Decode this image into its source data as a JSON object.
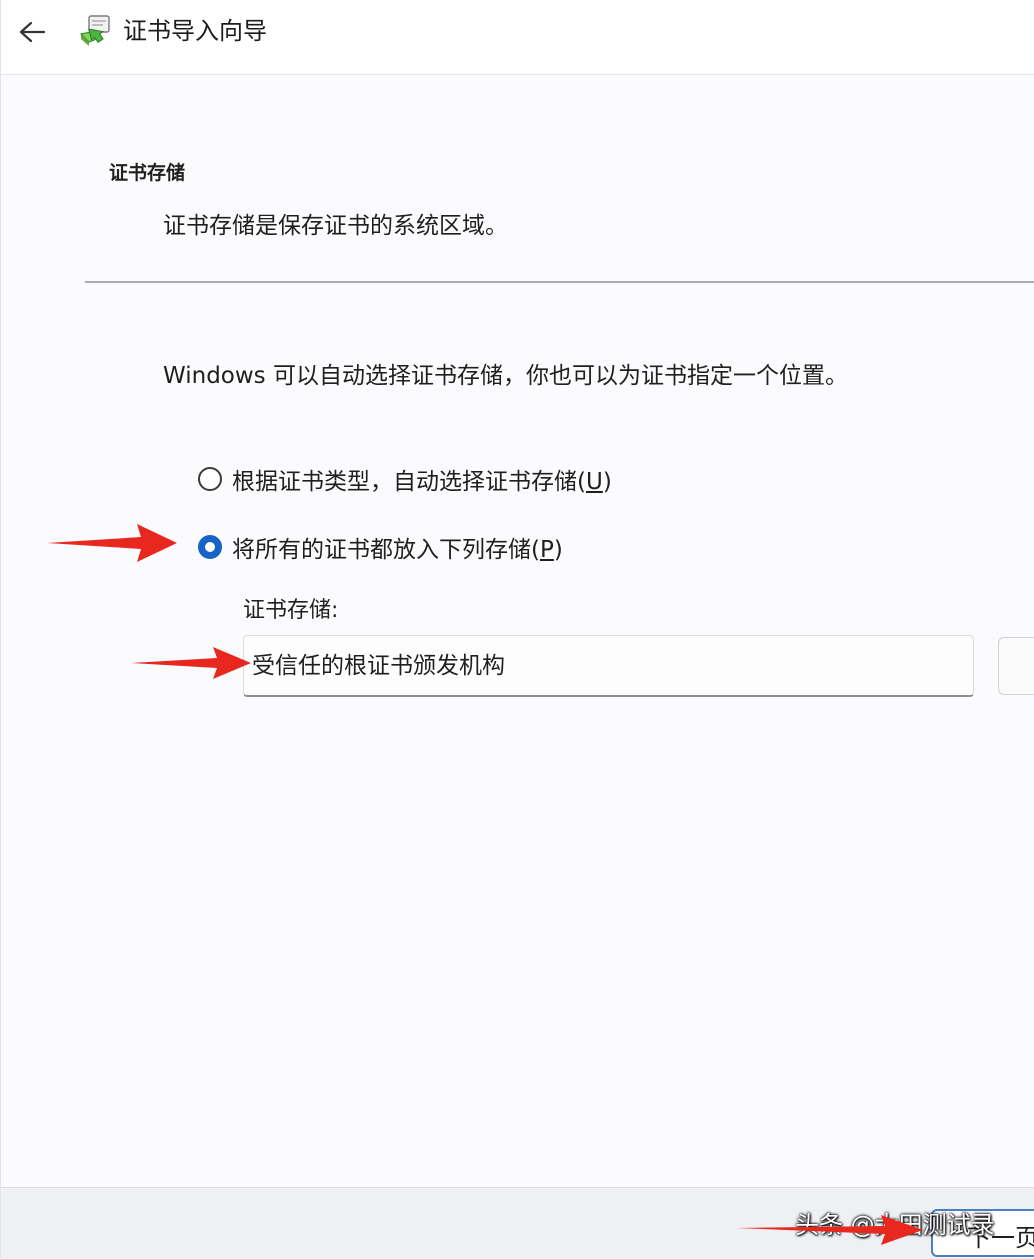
{
  "titlebar": {
    "back_icon": "arrow-left-icon",
    "wizard_icon": "certificate-wizard-icon",
    "title": "证书导入向导"
  },
  "section": {
    "heading": "证书存储",
    "description": "证书存储是保存证书的系统区域。"
  },
  "intro": "Windows 可以自动选择证书存储，你也可以为证书指定一个位置。",
  "options": [
    {
      "label": "根据证书类型，自动选择证书存储(",
      "hotkey": "U",
      "suffix": ")",
      "selected": false
    },
    {
      "label": "将所有的证书都放入下列存储(",
      "hotkey": "P",
      "suffix": ")",
      "selected": true
    }
  ],
  "store": {
    "label": "证书存储:",
    "value": "受信任的根证书颁发机构"
  },
  "footer": {
    "next_label": "下一页"
  },
  "watermark": "头条 @大田测试录",
  "colors": {
    "accent": "#1763c6",
    "annotation_arrow": "#e8281e",
    "footer_bg": "#eef0f4"
  }
}
